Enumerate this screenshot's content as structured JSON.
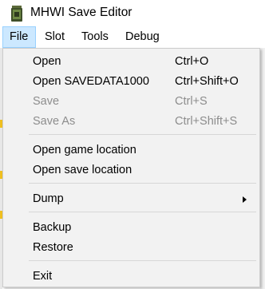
{
  "window": {
    "title": "MHWI Save Editor",
    "icon": "app-icon"
  },
  "menubar": {
    "items": [
      "File",
      "Slot",
      "Tools",
      "Debug"
    ],
    "active": "File"
  },
  "file_menu": {
    "open": {
      "label": "Open",
      "shortcut": "Ctrl+O"
    },
    "open_savedata": {
      "label": "Open SAVEDATA1000",
      "shortcut": "Ctrl+Shift+O"
    },
    "save": {
      "label": "Save",
      "shortcut": "Ctrl+S",
      "disabled": true
    },
    "save_as": {
      "label": "Save As",
      "shortcut": "Ctrl+Shift+S",
      "disabled": true
    },
    "open_game_location": {
      "label": "Open game location"
    },
    "open_save_location": {
      "label": "Open save location"
    },
    "dump": {
      "label": "Dump",
      "submenu_icon": "chevron-right-icon"
    },
    "backup": {
      "label": "Backup"
    },
    "restore": {
      "label": "Restore"
    },
    "exit": {
      "label": "Exit"
    }
  },
  "colors": {
    "menu_background": "#f2f2f2",
    "menu_border": "#cccccc",
    "active_menu_background": "#cce8ff",
    "active_menu_border": "#99d1ff",
    "disabled_text": "#8d8d8d",
    "separator": "#d7d7d7"
  }
}
